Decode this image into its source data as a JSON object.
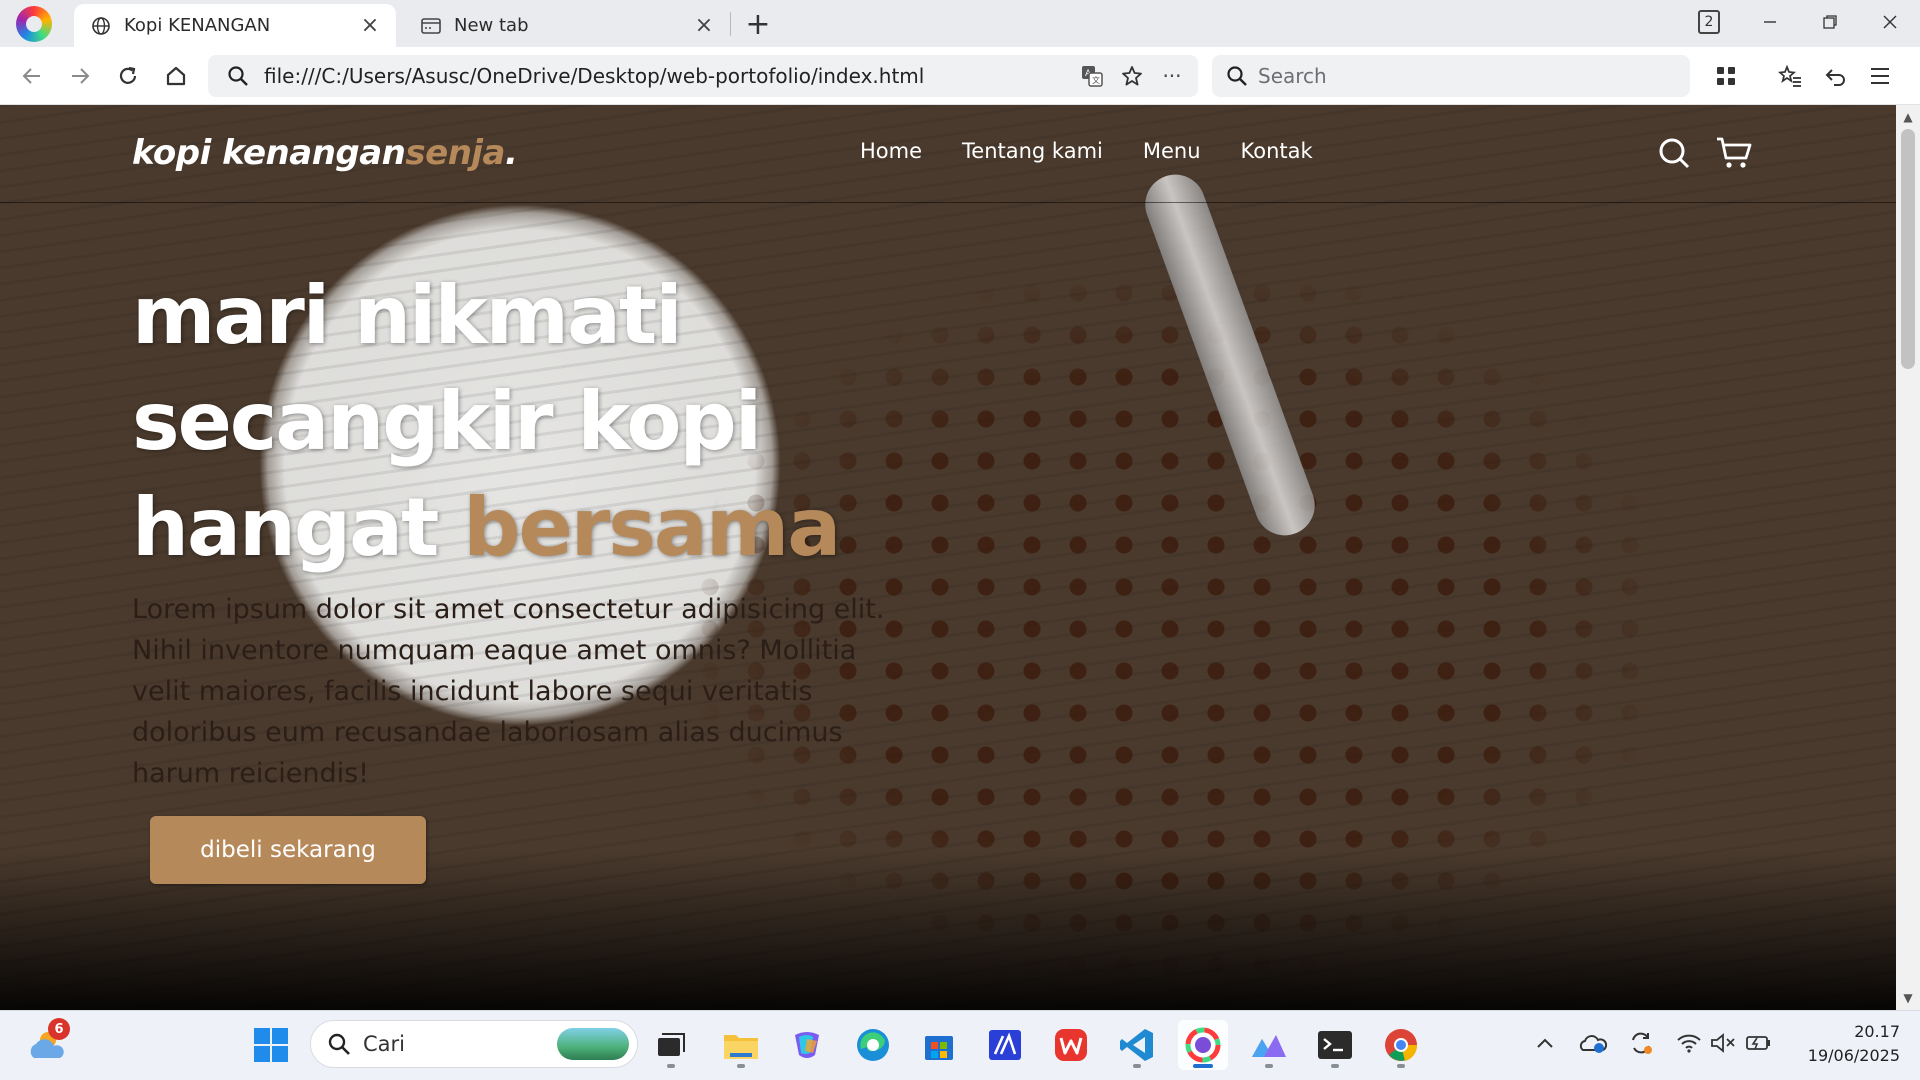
{
  "browser": {
    "tabs": [
      {
        "label": "Kopi KENANGAN",
        "icon": "globe-icon",
        "active": true
      },
      {
        "label": "New tab",
        "icon": "newtab-icon",
        "active": false
      }
    ],
    "tab_count": "2",
    "address": "file:///C:/Users/Asusc/OneDrive/Desktop/web-portofolio/index.html",
    "search_placeholder": "Search"
  },
  "site": {
    "logo_main": "kopi kenangan",
    "logo_accent": "senja",
    "logo_dot": ".",
    "nav": [
      "Home",
      "Tentang kami",
      "Menu",
      "Kontak"
    ],
    "hero_title_line1": "mari nikmati",
    "hero_title_line2": "secangkir kopi",
    "hero_title_line3": "hangat",
    "hero_title_accent": "bersama",
    "hero_text": "Lorem ipsum dolor sit amet consectetur adipisicing elit. Nihil inventore numquam eaque amet omnis? Mollitia velit maiores, facilis incidunt labore sequi veritatis doloribus eum recusandae laboriosam alias ducimus harum reiciendis!",
    "cta_label": "dibeli sekarang",
    "accent_color": "#b6895b"
  },
  "taskbar": {
    "weather_badge": "6",
    "search_label": "Cari",
    "apps": [
      "start-icon",
      "task-view-icon",
      "file-explorer-icon",
      "copilot-icon",
      "edge-icon",
      "store-icon",
      "app-icon",
      "wps-icon",
      "vscode-icon",
      "browser-icon",
      "paint-icon",
      "terminal-icon",
      "chrome-icon"
    ],
    "time": "20.17",
    "date": "19/06/2025"
  }
}
